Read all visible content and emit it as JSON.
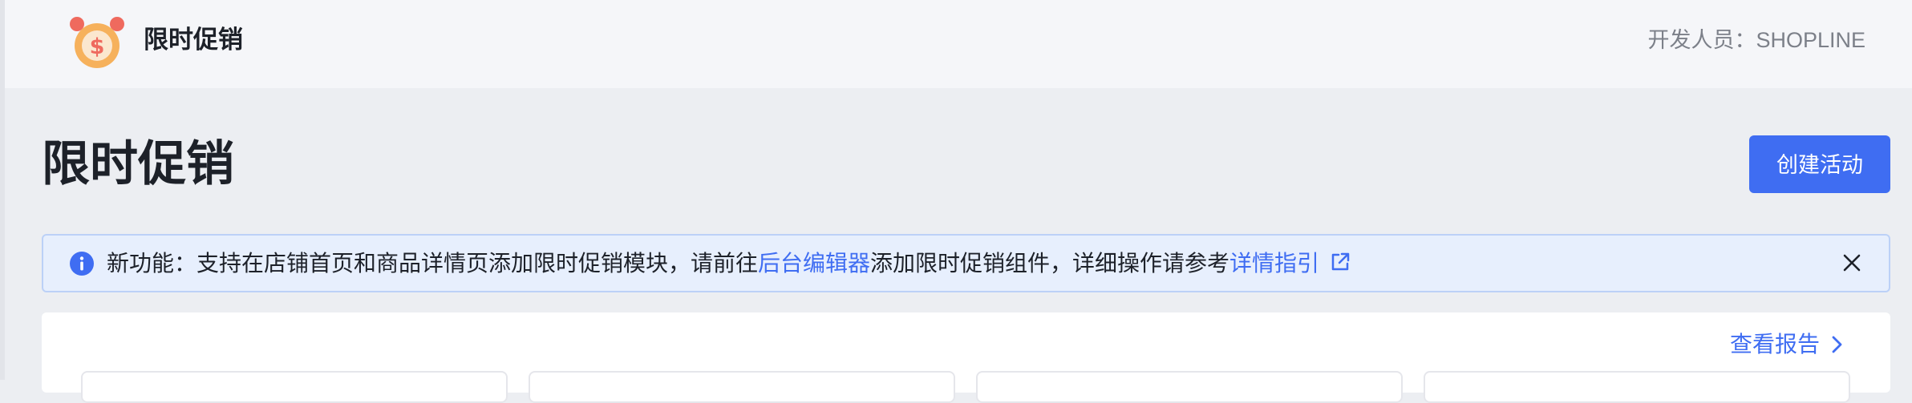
{
  "header": {
    "app_name": "限时促销",
    "developer": "开发人员：SHOPLINE",
    "app_icon": "alarm-clock-coin-icon"
  },
  "page": {
    "title": "限时促销",
    "create_button": "创建活动"
  },
  "notice": {
    "icon": "info-icon",
    "text_1": "新功能：支持在店铺首页和商品详情页添加限时促销模块，请前往",
    "link_1": "后台编辑器",
    "text_2": "添加限时促销组件，详细操作请参考",
    "link_2": "详情指引",
    "link_icon": "external-link-icon",
    "close_icon": "close-icon"
  },
  "report": {
    "link_label": "查看报告",
    "icon": "chevron-right-icon"
  },
  "colors": {
    "primary": "#3f6df2",
    "notice_bg": "#e7effd",
    "icon_orange": "#f6b15c",
    "icon_red": "#ef6a5e"
  }
}
